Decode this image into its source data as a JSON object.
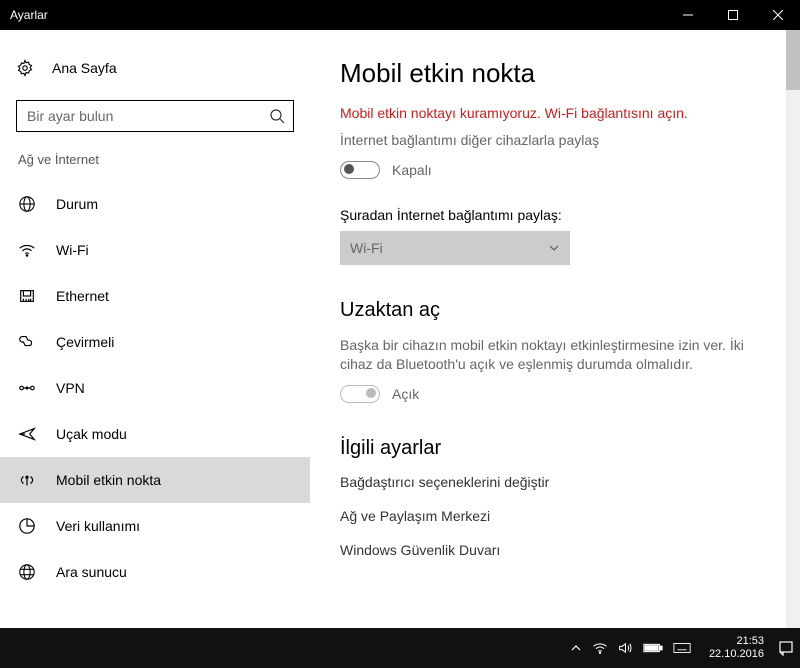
{
  "titlebar": {
    "title": "Ayarlar"
  },
  "sidebar": {
    "home": "Ana Sayfa",
    "search_placeholder": "Bir ayar bulun",
    "group": "Ağ ve İnternet",
    "items": [
      {
        "label": "Durum"
      },
      {
        "label": "Wi-Fi"
      },
      {
        "label": "Ethernet"
      },
      {
        "label": "Çevirmeli"
      },
      {
        "label": "VPN"
      },
      {
        "label": "Uçak modu"
      },
      {
        "label": "Mobil etkin nokta"
      },
      {
        "label": "Veri kullanımı"
      },
      {
        "label": "Ara sunucu"
      }
    ]
  },
  "content": {
    "title": "Mobil etkin nokta",
    "error": "Mobil etkin noktayı kuramıyoruz. Wi-Fi bağlantısını açın.",
    "share_desc": "İnternet bağlantımı diğer cihazlarla paylaş",
    "toggle1_label": "Kapalı",
    "share_from_label": "Şuradan İnternet bağlantımı paylaş:",
    "dropdown_value": "Wi-Fi",
    "remote_heading": "Uzaktan aç",
    "remote_desc": "Başka bir cihazın mobil etkin noktayı etkinleştirmesine izin ver. İki cihaz da Bluetooth'u açık ve eşlenmiş durumda olmalıdır.",
    "toggle2_label": "Açık",
    "related_heading": "İlgili ayarlar",
    "links": [
      "Bağdaştırıcı seçeneklerini değiştir",
      "Ağ ve Paylaşım Merkezi",
      "Windows Güvenlik Duvarı"
    ]
  },
  "taskbar": {
    "time": "21:53",
    "date": "22.10.2016"
  }
}
